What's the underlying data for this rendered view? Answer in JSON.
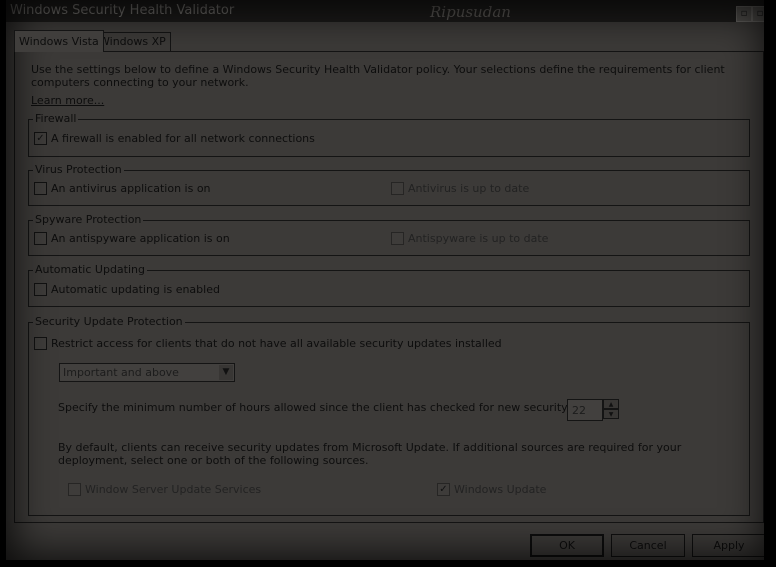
{
  "window": {
    "title": "Windows Security Health Validator",
    "watermark": "Ripusudan"
  },
  "tabs": [
    {
      "label": "Windows Vista",
      "active": true
    },
    {
      "label": "Windows XP",
      "active": false
    }
  ],
  "description": "Use the settings below to define a Windows Security Health Validator policy. Your selections define the requirements for client computers connecting to your network.",
  "learn_more": "Learn more...",
  "firewall": {
    "legend": "Firewall",
    "enabled": {
      "label": "A firewall is enabled for all network connections",
      "checked": true
    }
  },
  "virus": {
    "legend": "Virus Protection",
    "app_on": {
      "label": "An antivirus application is on",
      "checked": false
    },
    "up_to_date": {
      "label": "Antivirus is up to date",
      "checked": false,
      "disabled": true
    }
  },
  "spyware": {
    "legend": "Spyware Protection",
    "app_on": {
      "label": "An antispyware application is on",
      "checked": false
    },
    "up_to_date": {
      "label": "Antispyware is up to date",
      "checked": false,
      "disabled": true
    }
  },
  "updating": {
    "legend": "Automatic Updating",
    "enabled": {
      "label": "Automatic updating is enabled",
      "checked": false
    }
  },
  "security_updates": {
    "legend": "Security Update Protection",
    "restrict": {
      "label": "Restrict access for clients that do not have all available security updates installed",
      "checked": false
    },
    "severity": "Important and above",
    "hours_label": "Specify the minimum number of hours allowed since the client has checked for new security updates:",
    "hours_value": "22",
    "sources_text": "By default, clients can receive security updates from Microsoft Update.  If additional sources are required for your deployment, select one or both of the following sources.",
    "wsus": {
      "label": "Window Server Update Services",
      "checked": false,
      "disabled": true
    },
    "windows_update": {
      "label": "Windows Update",
      "checked": true,
      "disabled": true
    }
  },
  "buttons": {
    "ok": "OK",
    "cancel": "Cancel",
    "apply": "Apply"
  },
  "glyphs": {
    "check": "✓",
    "dropdown": "▼",
    "spin_up": "▲",
    "spin_down": "▼",
    "title_btn": "▫"
  }
}
